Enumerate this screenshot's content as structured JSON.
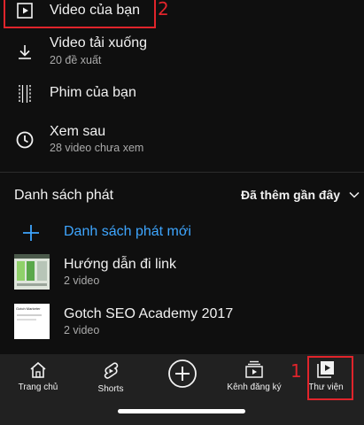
{
  "menu": {
    "your_videos": {
      "title": "Video của bạn",
      "icon": "play-square-icon"
    },
    "downloads": {
      "title": "Video tải xuống",
      "subtitle": "20 đề xuất",
      "icon": "download-icon"
    },
    "your_movies": {
      "title": "Phim của bạn",
      "icon": "film-strip-icon"
    },
    "watch_later": {
      "title": "Xem sau",
      "subtitle": "28 video chưa xem",
      "icon": "clock-icon"
    }
  },
  "playlists": {
    "header": "Danh sách phát",
    "sort_label": "Đã thêm gần đây",
    "new_playlist": "Danh sách phát mới",
    "items": [
      {
        "title": "Hướng dẫn đi link",
        "subtitle": "2 video"
      },
      {
        "title": "Gotch SEO Academy 2017",
        "subtitle": "2 video"
      }
    ]
  },
  "thumbs": {
    "second_caption": "Gotch Marketer"
  },
  "nav": {
    "home": "Trang chủ",
    "shorts": "Shorts",
    "subscriptions": "Kênh đăng ký",
    "library": "Thư viện"
  },
  "annotations": {
    "one": "1",
    "two": "2"
  },
  "colors": {
    "background": "#0f0f0f",
    "navbar": "#212121",
    "accent_blue": "#3ea6ff",
    "annotation_red": "#e0242b",
    "secondary_text": "#aaaaaa"
  }
}
